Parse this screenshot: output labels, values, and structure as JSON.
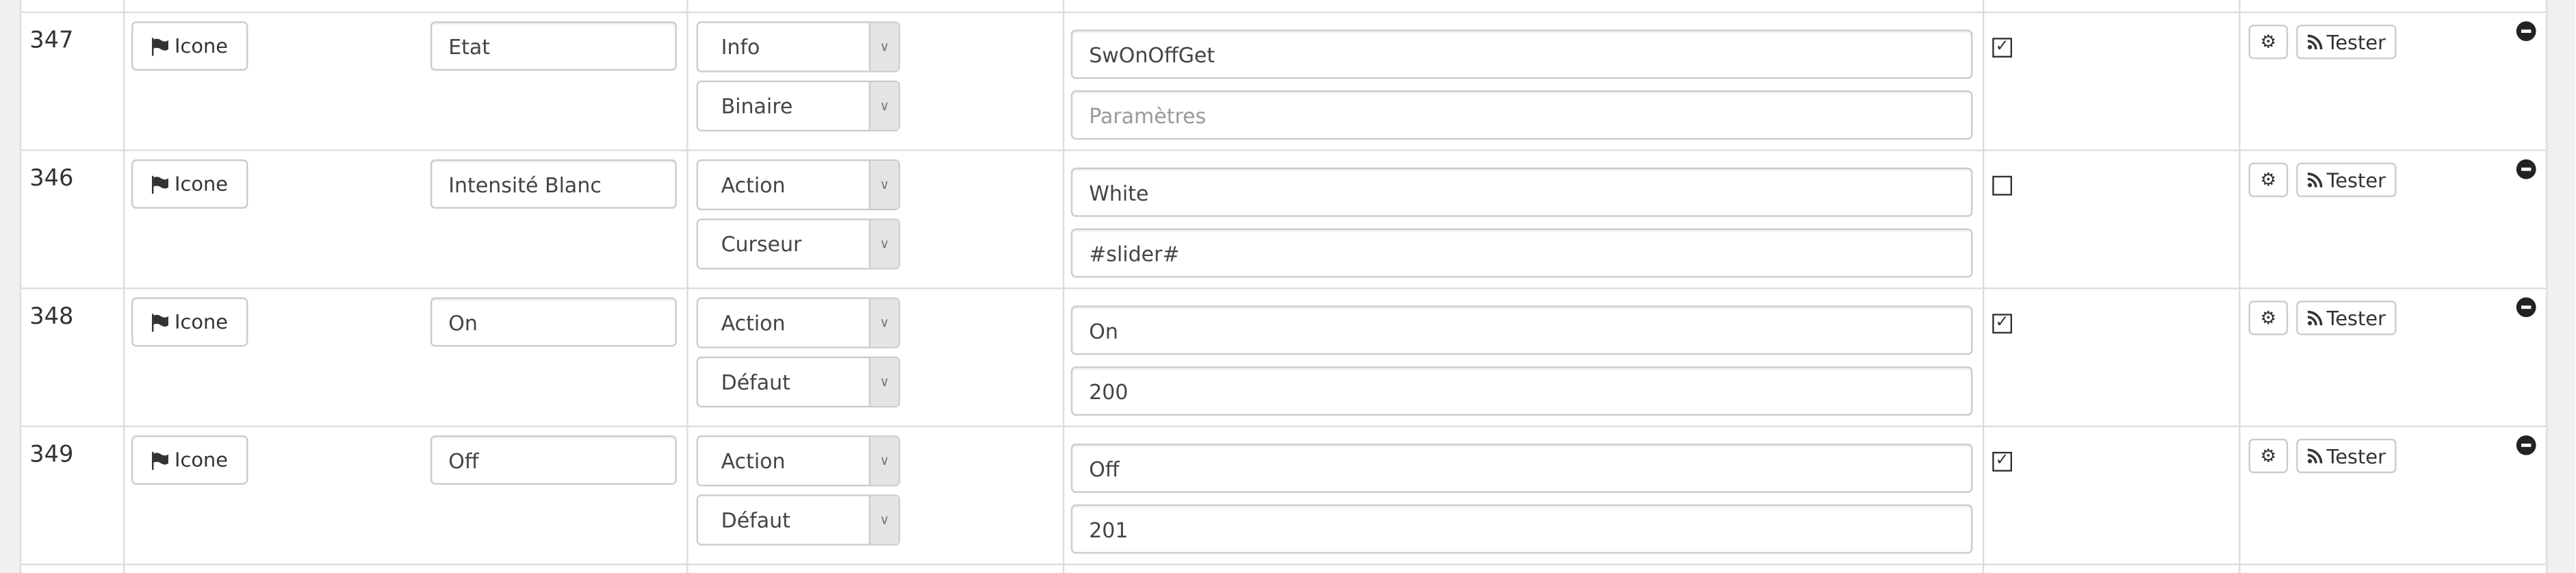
{
  "icons": {
    "icon_button": "flag-icon",
    "config_button": "cogs-icon",
    "test_button": "rss-icon",
    "remove": "minus-circle-icon"
  },
  "labels": {
    "icon_button": "Icone",
    "test_button": "Tester"
  },
  "rows": [
    {
      "id": "347",
      "name": "Etat",
      "type": "Info",
      "subtype": "Binaire",
      "logical_id": "SwOnOffGet",
      "parameters": "",
      "parameters_placeholder": "Paramètres",
      "checked": true
    },
    {
      "id": "346",
      "name": "Intensité Blanc",
      "type": "Action",
      "subtype": "Curseur",
      "logical_id": "White",
      "parameters": "#slider#",
      "parameters_placeholder": "",
      "checked": false
    },
    {
      "id": "348",
      "name": "On",
      "type": "Action",
      "subtype": "Défaut",
      "logical_id": "On",
      "parameters": "200",
      "parameters_placeholder": "",
      "checked": true
    },
    {
      "id": "349",
      "name": "Off",
      "type": "Action",
      "subtype": "Défaut",
      "logical_id": "Off",
      "parameters": "201",
      "parameters_placeholder": "",
      "checked": true
    }
  ]
}
